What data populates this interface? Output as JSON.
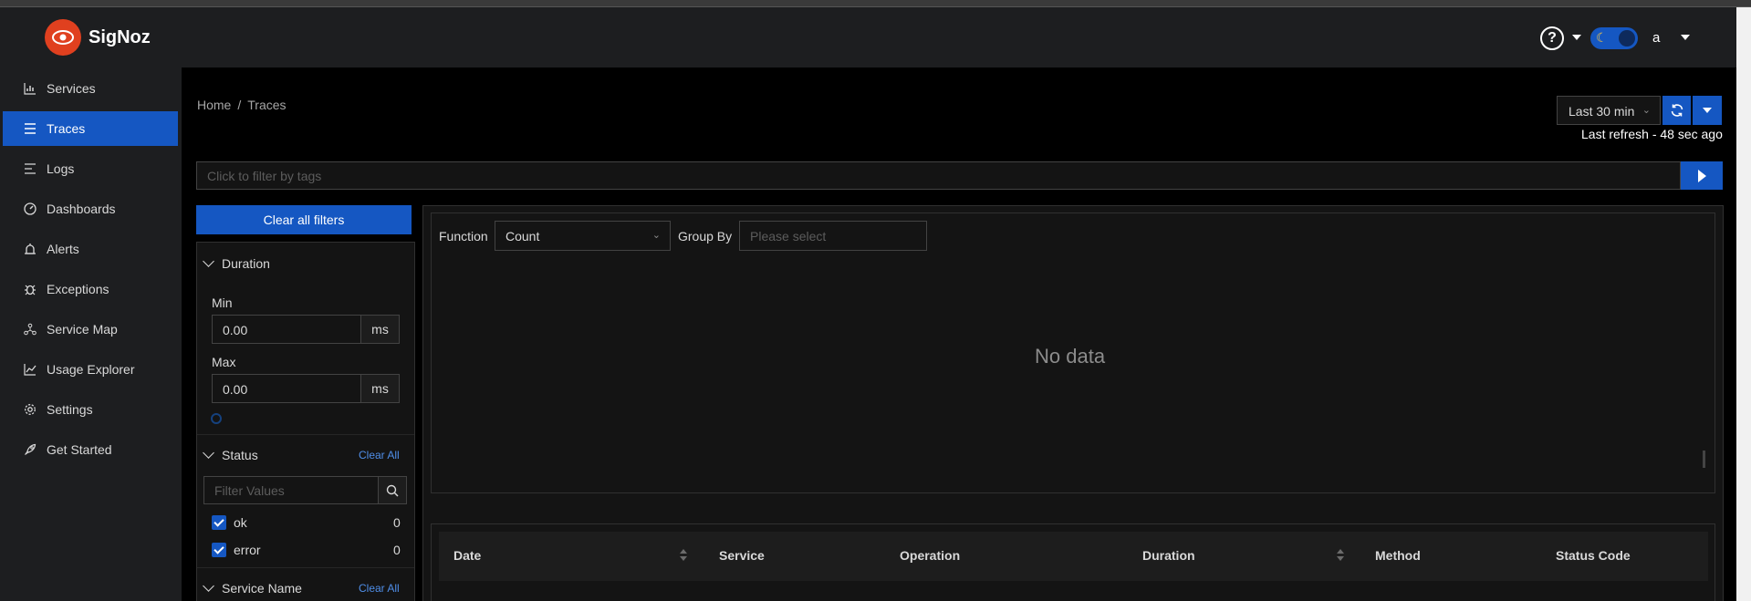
{
  "app": {
    "name": "SigNoz"
  },
  "header": {
    "help_icon": "question-circle-icon",
    "theme_toggle_icon": "moon-icon",
    "user_initial": "a"
  },
  "sidebar": {
    "items": [
      {
        "label": "Services",
        "icon": "bar-chart-icon"
      },
      {
        "label": "Traces",
        "icon": "menu-lines-icon",
        "active": true
      },
      {
        "label": "Logs",
        "icon": "align-left-icon"
      },
      {
        "label": "Dashboards",
        "icon": "dashboard-icon"
      },
      {
        "label": "Alerts",
        "icon": "alarm-icon"
      },
      {
        "label": "Exceptions",
        "icon": "bug-icon"
      },
      {
        "label": "Service Map",
        "icon": "deployment-unit-icon"
      },
      {
        "label": "Usage Explorer",
        "icon": "line-chart-icon"
      },
      {
        "label": "Settings",
        "icon": "gear-icon"
      },
      {
        "label": "Get Started",
        "icon": "rocket-icon"
      }
    ]
  },
  "breadcrumb": {
    "home": "Home",
    "separator": "/",
    "current": "Traces"
  },
  "time_range": {
    "selected": "Last 30 min",
    "last_refresh": "Last refresh - 48 sec ago"
  },
  "tag_filter": {
    "placeholder": "Click to filter by tags"
  },
  "filters": {
    "clear_all_label": "Clear all filters",
    "duration": {
      "title": "Duration",
      "min_label": "Min",
      "min_value": "0.00",
      "min_unit": "ms",
      "max_label": "Max",
      "max_value": "0.00",
      "max_unit": "ms"
    },
    "status": {
      "title": "Status",
      "clear_label": "Clear All",
      "search_placeholder": "Filter Values",
      "options": [
        {
          "label": "ok",
          "count": "0",
          "checked": true
        },
        {
          "label": "error",
          "count": "0",
          "checked": true
        }
      ]
    },
    "service_name": {
      "title": "Service Name",
      "clear_label": "Clear All"
    }
  },
  "chart": {
    "function_label": "Function",
    "function_value": "Count",
    "group_by_label": "Group By",
    "group_by_placeholder": "Please select",
    "empty_text": "No data"
  },
  "table": {
    "columns": [
      "Date",
      "Service",
      "Operation",
      "Duration",
      "Method",
      "Status Code"
    ]
  },
  "colors": {
    "accent": "#1557c2",
    "brand": "#e0401f",
    "panel": "#141414",
    "sidebar": "#1d1e20"
  }
}
